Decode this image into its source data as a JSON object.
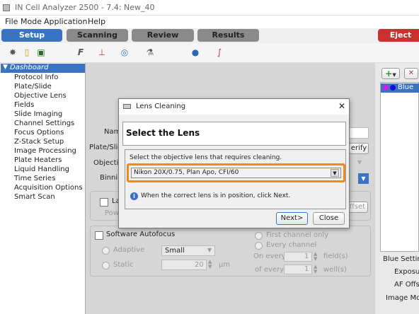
{
  "window": {
    "title": "IN Cell Analyzer 2500 - 7.4: New_40"
  },
  "menu": {
    "items": [
      "File",
      "Mode",
      "Application",
      "Help"
    ]
  },
  "tabs": [
    "Setup",
    "Scanning",
    "Review",
    "Results"
  ],
  "eject_label": "Eject",
  "colors": {
    "active_tab": "#3a72c4",
    "tab": "#8a8a8a",
    "eject": "#c8312e",
    "sidebar_selected": "#3a72c4",
    "dialog_highlight": "#f08a1e"
  },
  "sidebar": {
    "header": "Dashboard",
    "items": [
      "Protocol Info",
      "Plate/Slide",
      "Objective Lens",
      "Fields",
      "Slide Imaging",
      "Channel Settings",
      "Focus Options",
      "Z-Stack Setup",
      "Image Processing",
      "Plate Heaters",
      "Liquid Handling",
      "Time Series",
      "Acquisition Options",
      "Smart Scan"
    ]
  },
  "main": {
    "labels": {
      "name": "Nam",
      "plate": "Plate/Slid",
      "objective": "Objective",
      "binning": "Binning",
      "verify": "erify",
      "la": "La",
      "pow": "Pow",
      "offset": "ffset"
    },
    "software_autofocus": "Software Autofocus",
    "adaptive": "Adaptive",
    "static": "Static",
    "adaptive_value": "Small",
    "static_value": "20",
    "static_unit": "μm",
    "first_channel": "First channel only",
    "every_channel": "Every channel",
    "on_every": "On every",
    "of_every": "of every",
    "field_value": "1",
    "well_value": "1",
    "field_unit": "field(s)",
    "well_unit": "well(s)"
  },
  "right": {
    "channel": "Blue",
    "blue_settings": "Blue Setting",
    "exposure": "Exposur",
    "af_offset": "AF Offse",
    "image_mode": "Image Mod"
  },
  "dialog": {
    "title": "Lens Cleaning",
    "heading": "Select the Lens",
    "instruction": "Select the objective lens that requires cleaning.",
    "selected_lens": "Nikon 20X/0.75, Plan Apo, CFI/60",
    "info": "When the correct lens is in position, click Next.",
    "next": "Next>",
    "close": "Close"
  }
}
